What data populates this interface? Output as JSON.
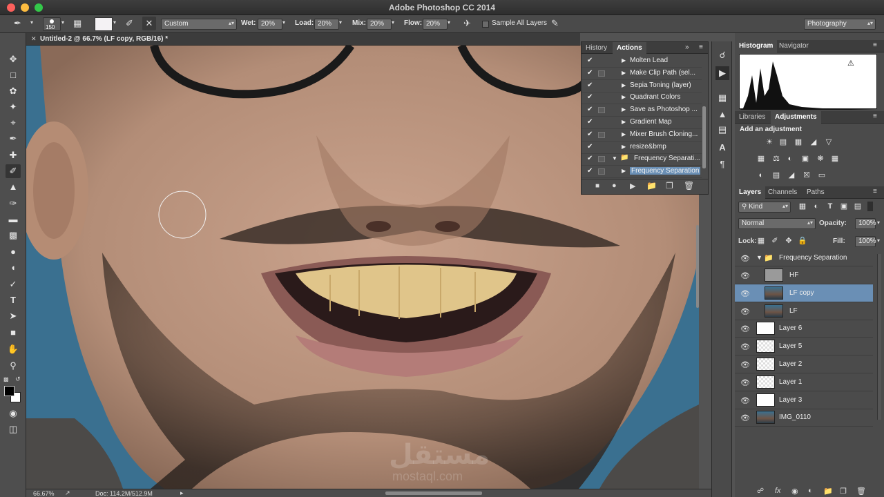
{
  "window": {
    "title": "Adobe Photoshop CC 2014"
  },
  "options_bar": {
    "brush_size": "150",
    "preset": "Custom",
    "wet_label": "Wet:",
    "wet": "20%",
    "load_label": "Load:",
    "load": "20%",
    "mix_label": "Mix:",
    "mix": "20%",
    "flow_label": "Flow:",
    "flow": "20%",
    "sample_all_label": "Sample All Layers",
    "workspace": "Photography"
  },
  "document": {
    "tab_title": "Untitled-2 @ 66.7% (LF copy, RGB/16) *"
  },
  "status": {
    "zoom": "66.67%",
    "doc": "Doc: 114.2M/512.9M"
  },
  "watermark": {
    "arabic": "مستقل",
    "latin": "mostaql.com"
  },
  "actions_panel": {
    "tabs": [
      "History",
      "Actions"
    ],
    "active_tab": "Actions",
    "items": [
      {
        "name": "Molten Lead",
        "dialog": false,
        "indent": 0,
        "open": false
      },
      {
        "name": "Make Clip Path (sel...",
        "dialog": true,
        "indent": 0,
        "open": false
      },
      {
        "name": "Sepia Toning (layer)",
        "dialog": false,
        "indent": 0,
        "open": false
      },
      {
        "name": "Quadrant Colors",
        "dialog": false,
        "indent": 0,
        "open": false
      },
      {
        "name": "Save as Photoshop ...",
        "dialog": true,
        "indent": 0,
        "open": false
      },
      {
        "name": "Gradient Map",
        "dialog": false,
        "indent": 0,
        "open": false
      },
      {
        "name": "Mixer Brush Cloning...",
        "dialog": true,
        "indent": 0,
        "open": false
      },
      {
        "name": "resize&bmp",
        "dialog": false,
        "indent": 0,
        "open": false
      },
      {
        "name": "Frequency Separati...",
        "dialog": true,
        "indent": 0,
        "open": true,
        "folder": true
      },
      {
        "name": "Frequency Separation",
        "dialog": true,
        "indent": 1,
        "open": false,
        "selected": true
      }
    ]
  },
  "histogram_panel": {
    "tabs": [
      "Histogram",
      "Navigator"
    ],
    "active_tab": "Histogram"
  },
  "adjustments_panel": {
    "tabs": [
      "Libraries",
      "Adjustments"
    ],
    "active_tab": "Adjustments",
    "heading": "Add an adjustment"
  },
  "layers_panel": {
    "tabs": [
      "Layers",
      "Channels",
      "Paths"
    ],
    "active_tab": "Layers",
    "filter": "Kind",
    "blend_mode": "Normal",
    "opacity_label": "Opacity:",
    "opacity": "100%",
    "lock_label": "Lock:",
    "fill_label": "Fill:",
    "fill": "100%",
    "group": "Frequency Separation",
    "layers": [
      {
        "name": "HF",
        "thumb": "gray",
        "in_group": true
      },
      {
        "name": "LF copy",
        "thumb": "photo",
        "in_group": true,
        "selected": true
      },
      {
        "name": "LF",
        "thumb": "photo",
        "in_group": true
      },
      {
        "name": "Layer 6",
        "thumb": "white"
      },
      {
        "name": "Layer 5",
        "thumb": "checker"
      },
      {
        "name": "Layer 2",
        "thumb": "checker"
      },
      {
        "name": "Layer 1",
        "thumb": "checker"
      },
      {
        "name": "Layer 3",
        "thumb": "white"
      },
      {
        "name": "IMG_0110",
        "thumb": "photo"
      }
    ]
  }
}
